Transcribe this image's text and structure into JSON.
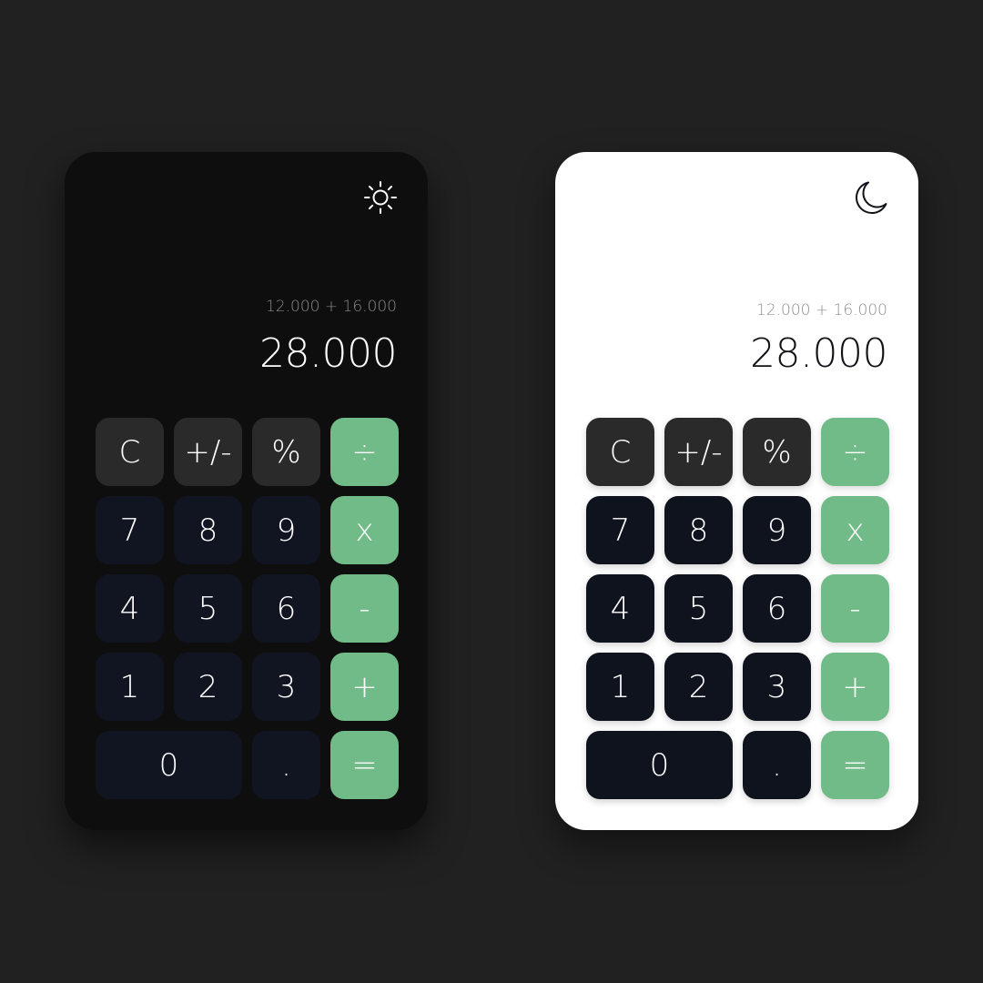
{
  "colors": {
    "background": "#212121",
    "dark_body": "#0e0e0e",
    "light_body": "#ffffff",
    "function_key": "#2a2a2a",
    "number_key": "#101521",
    "operator_key": "#70bb87"
  },
  "dark": {
    "theme_icon": "sun-icon",
    "expression": "12.000 + 16.000",
    "result": "28.000",
    "keys": {
      "clear": "C",
      "sign": "+/-",
      "percent": "%",
      "divide": "÷",
      "seven": "7",
      "eight": "8",
      "nine": "9",
      "multiply": "x",
      "four": "4",
      "five": "5",
      "six": "6",
      "subtract": "-",
      "one": "1",
      "two": "2",
      "three": "3",
      "add": "+",
      "zero": "0",
      "decimal": ".",
      "equals": "="
    }
  },
  "light": {
    "theme_icon": "moon-icon",
    "expression": "12.000 + 16.000",
    "result": "28.000",
    "keys": {
      "clear": "C",
      "sign": "+/-",
      "percent": "%",
      "divide": "÷",
      "seven": "7",
      "eight": "8",
      "nine": "9",
      "multiply": "x",
      "four": "4",
      "five": "5",
      "six": "6",
      "subtract": "-",
      "one": "1",
      "two": "2",
      "three": "3",
      "add": "+",
      "zero": "0",
      "decimal": ".",
      "equals": "="
    }
  }
}
